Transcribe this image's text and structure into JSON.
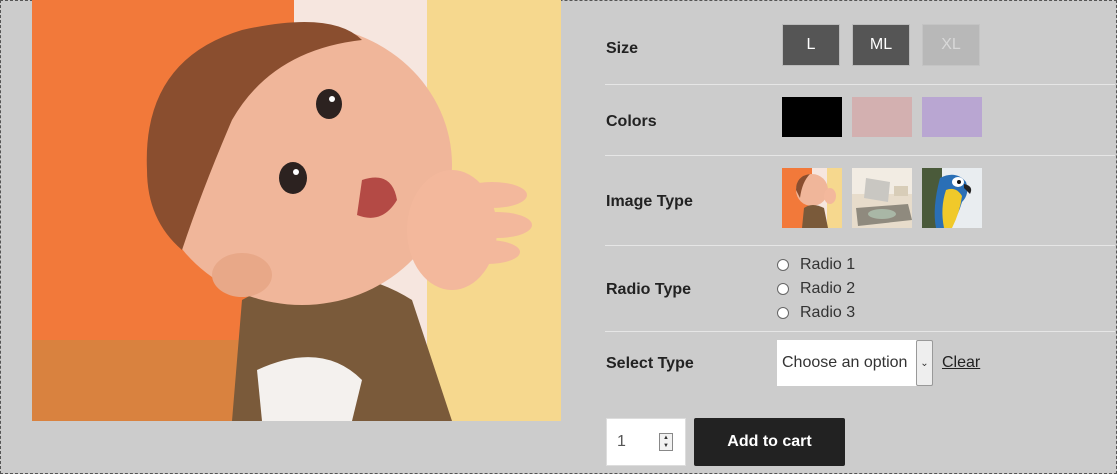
{
  "variations": {
    "size": {
      "label": "Size",
      "options": [
        {
          "label": "L",
          "state": "available"
        },
        {
          "label": "ML",
          "state": "available"
        },
        {
          "label": "XL",
          "state": "disabled"
        }
      ]
    },
    "colors": {
      "label": "Colors",
      "swatches": [
        "#000000",
        "#d3b0b0",
        "#b9a6d2"
      ]
    },
    "image_type": {
      "label": "Image Type",
      "swatches": [
        "baby-photo-thumbnail",
        "laptop-photo-thumbnail",
        "parrot-photo-thumbnail"
      ]
    },
    "radio_type": {
      "label": "Radio Type",
      "options": [
        "Radio 1",
        "Radio 2",
        "Radio 3"
      ]
    },
    "select_type": {
      "label": "Select Type",
      "selected": "Choose an option",
      "clear_label": "Clear"
    }
  },
  "cart": {
    "quantity": "1",
    "add_to_cart_label": "Add to cart"
  }
}
